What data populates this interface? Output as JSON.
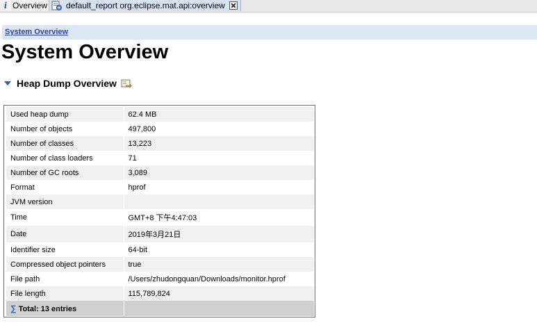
{
  "tabs": [
    {
      "label": "Overview"
    },
    {
      "label": "default_report  org.eclipse.mat.api:overview"
    }
  ],
  "breadcrumb": {
    "label": "System Overview"
  },
  "page_title": "System Overview",
  "section": {
    "title": "Heap Dump Overview"
  },
  "table": {
    "rows": [
      {
        "key": "Used heap dump",
        "value": "62.4 MB"
      },
      {
        "key": "Number of objects",
        "value": "497,800"
      },
      {
        "key": "Number of classes",
        "value": "13,223"
      },
      {
        "key": "Number of class loaders",
        "value": "71"
      },
      {
        "key": "Number of GC roots",
        "value": "3,089"
      },
      {
        "key": "Format",
        "value": "hprof"
      },
      {
        "key": "JVM version",
        "value": ""
      },
      {
        "key": "Time",
        "value": "GMT+8 下午4:47:03"
      },
      {
        "key": "Date",
        "value": "2019年3月21日"
      },
      {
        "key": "Identifier size",
        "value": "64-bit"
      },
      {
        "key": "Compressed object pointers",
        "value": "true"
      },
      {
        "key": "File path",
        "value": "/Users/zhudongquan/Downloads/monitor.hprof"
      },
      {
        "key": "File length",
        "value": "115,789,824"
      }
    ],
    "total_label": "Total: 13 entries"
  },
  "icons": {
    "tab_overview": "info-icon",
    "tab_report": "report-icon",
    "tab_close": "close-icon",
    "section_toggle": "chevron-down-icon",
    "section_export": "export-icon",
    "total": "sigma-icon"
  },
  "colors": {
    "link": "#2d3fa8",
    "crumb_bar": "#dbe8f4",
    "accent": "#2f5cb5"
  }
}
